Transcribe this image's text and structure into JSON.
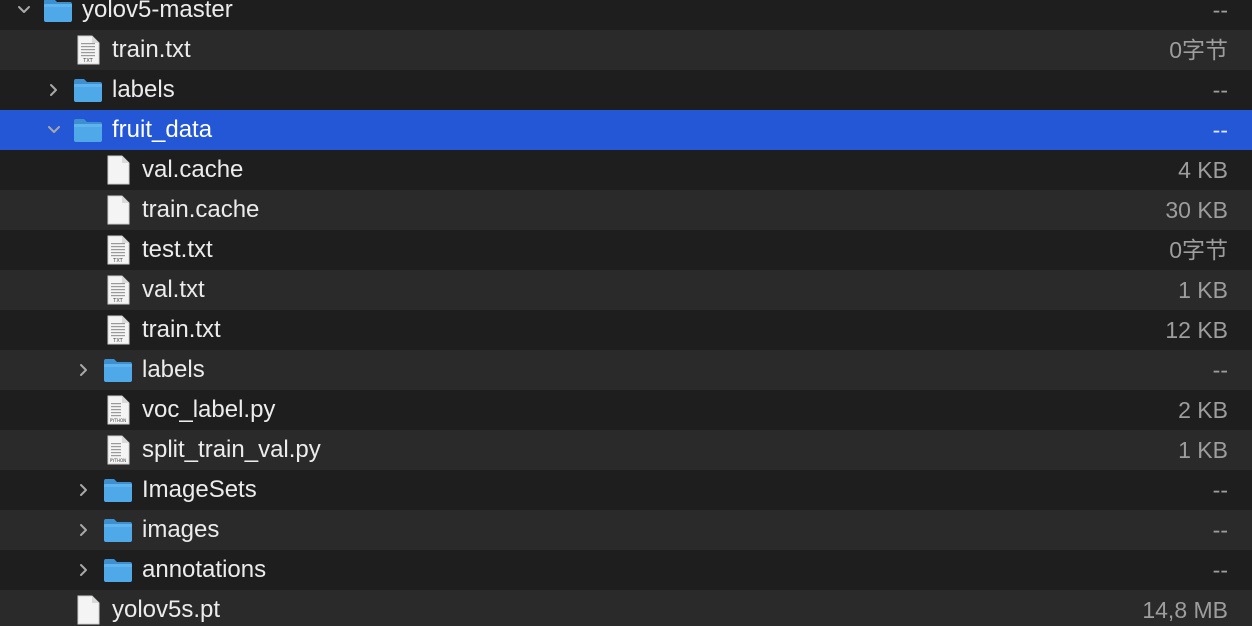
{
  "file_list": [
    {
      "name": "yolov5-master",
      "size": "--",
      "kind": "folder",
      "depth": 0,
      "expanded": true,
      "icon": "folder-icon"
    },
    {
      "name": "train.txt",
      "size": "0字节",
      "kind": "txt",
      "depth": 1,
      "icon": "txt-file-icon"
    },
    {
      "name": "labels",
      "size": "--",
      "kind": "folder",
      "depth": 1,
      "expanded": false,
      "icon": "folder-icon"
    },
    {
      "name": "fruit_data",
      "size": "--",
      "kind": "folder",
      "depth": 1,
      "expanded": true,
      "selected": true,
      "icon": "folder-icon"
    },
    {
      "name": "val.cache",
      "size": "4 KB",
      "kind": "file",
      "depth": 2,
      "icon": "blank-file-icon"
    },
    {
      "name": "train.cache",
      "size": "30 KB",
      "kind": "file",
      "depth": 2,
      "icon": "blank-file-icon"
    },
    {
      "name": "test.txt",
      "size": "0字节",
      "kind": "txt",
      "depth": 2,
      "icon": "txt-file-icon"
    },
    {
      "name": "val.txt",
      "size": "1 KB",
      "kind": "txt",
      "depth": 2,
      "icon": "txt-file-icon"
    },
    {
      "name": "train.txt",
      "size": "12 KB",
      "kind": "txt",
      "depth": 2,
      "icon": "txt-file-icon"
    },
    {
      "name": "labels",
      "size": "--",
      "kind": "folder",
      "depth": 2,
      "expanded": false,
      "icon": "folder-icon"
    },
    {
      "name": "voc_label.py",
      "size": "2 KB",
      "kind": "py",
      "depth": 2,
      "icon": "python-file-icon"
    },
    {
      "name": "split_train_val.py",
      "size": "1 KB",
      "kind": "py",
      "depth": 2,
      "icon": "python-file-icon"
    },
    {
      "name": "ImageSets",
      "size": "--",
      "kind": "folder",
      "depth": 2,
      "expanded": false,
      "icon": "folder-icon"
    },
    {
      "name": "images",
      "size": "--",
      "kind": "folder",
      "depth": 2,
      "expanded": false,
      "icon": "folder-icon"
    },
    {
      "name": "annotations",
      "size": "--",
      "kind": "folder",
      "depth": 2,
      "expanded": false,
      "icon": "folder-icon"
    },
    {
      "name": "yolov5s.pt",
      "size": "14,8 MB",
      "kind": "file",
      "depth": 1,
      "icon": "blank-file-icon"
    }
  ],
  "badges": {
    "txt": "TXT",
    "py": "PYTHON"
  },
  "colors": {
    "selection": "#2457d6",
    "folder": "#4fa8e8",
    "row_alt": "#2a2a2a",
    "row_base": "#1e1e1e"
  }
}
